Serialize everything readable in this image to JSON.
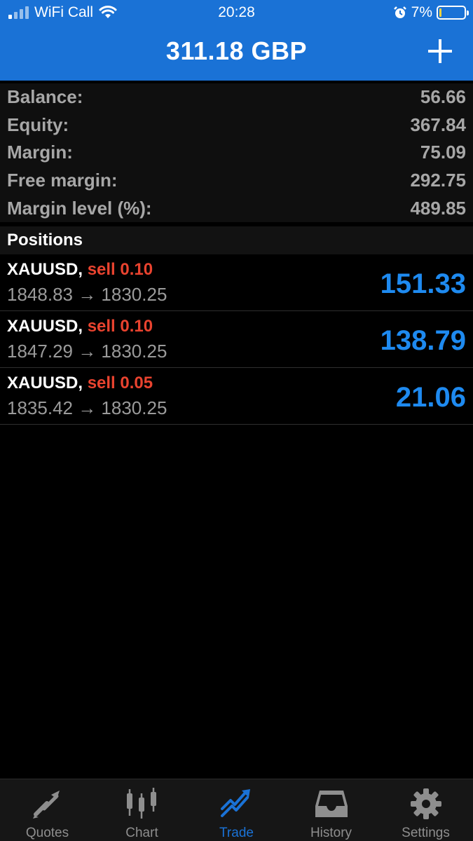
{
  "status_bar": {
    "carrier": "WiFi Call",
    "time": "20:28",
    "battery": "7%"
  },
  "header": {
    "title": "311.18 GBP"
  },
  "summary": [
    {
      "label": "Balance:",
      "value": "56.66"
    },
    {
      "label": "Equity:",
      "value": "367.84"
    },
    {
      "label": "Margin:",
      "value": "75.09"
    },
    {
      "label": "Free margin:",
      "value": "292.75"
    },
    {
      "label": "Margin level (%):",
      "value": "489.85"
    }
  ],
  "positions": {
    "title": "Positions",
    "items": [
      {
        "symbol": "XAUUSD,",
        "side": "sell 0.10",
        "prices": "1848.83 → 1830.25",
        "profit": "151.33"
      },
      {
        "symbol": "XAUUSD,",
        "side": "sell 0.10",
        "prices": "1847.29 → 1830.25",
        "profit": "138.79"
      },
      {
        "symbol": "XAUUSD,",
        "side": "sell 0.05",
        "prices": "1835.42 → 1830.25",
        "profit": "21.06"
      }
    ]
  },
  "tabs": [
    {
      "label": "Quotes",
      "icon": "quotes-icon"
    },
    {
      "label": "Chart",
      "icon": "chart-icon"
    },
    {
      "label": "Trade",
      "icon": "trade-icon",
      "active": true
    },
    {
      "label": "History",
      "icon": "history-icon"
    },
    {
      "label": "Settings",
      "icon": "settings-icon"
    }
  ],
  "colors": {
    "header_bg": "#1a72d6",
    "sell": "#e9432f",
    "profit": "#1e8af0",
    "active_tab": "#1a72d6"
  }
}
